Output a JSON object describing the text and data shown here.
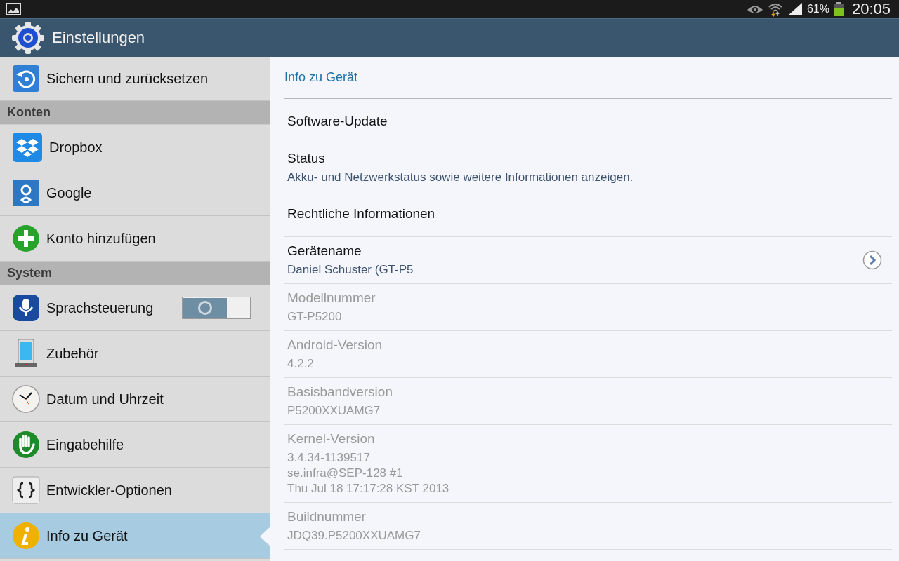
{
  "status_bar": {
    "battery": "61%",
    "time": "20:05"
  },
  "action_bar": {
    "title": "Einstellungen"
  },
  "sidebar": {
    "items": [
      {
        "kind": "item",
        "label": "Sichern und zurücksetzen",
        "selected": false
      },
      {
        "kind": "header",
        "label": "Konten"
      },
      {
        "kind": "item",
        "label": "Dropbox",
        "selected": false
      },
      {
        "kind": "item",
        "label": "Google",
        "selected": false
      },
      {
        "kind": "item",
        "label": "Konto hinzufügen",
        "selected": false
      },
      {
        "kind": "header",
        "label": "System"
      },
      {
        "kind": "toggle",
        "label": "Sprachsteuerung",
        "selected": false,
        "on": false
      },
      {
        "kind": "item",
        "label": "Zubehör",
        "selected": false
      },
      {
        "kind": "item",
        "label": "Datum und Uhrzeit",
        "selected": false
      },
      {
        "kind": "item",
        "label": "Eingabehilfe",
        "selected": false
      },
      {
        "kind": "item",
        "label": "Entwickler-Optionen",
        "selected": false
      },
      {
        "kind": "item",
        "label": "Info zu Gerät",
        "selected": true
      }
    ]
  },
  "detail": {
    "title": "Info zu Gerät",
    "rows": [
      {
        "title": "Software-Update",
        "disabled": false
      },
      {
        "title": "Status",
        "subtitle": "Akku- und Netzwerkstatus sowie weitere Informationen anzeigen.",
        "disabled": false
      },
      {
        "title": "Rechtliche Informationen",
        "disabled": false
      },
      {
        "title": "Gerätename",
        "subtitle": "Daniel Schuster (GT-P5",
        "disabled": false,
        "chevron": true
      },
      {
        "title": "Modellnummer",
        "subtitle": "GT-P5200",
        "disabled": true
      },
      {
        "title": "Android-Version",
        "subtitle": "4.2.2",
        "disabled": true
      },
      {
        "title": "Basisbandversion",
        "subtitle": "P5200XXUAMG7",
        "disabled": true
      },
      {
        "title": "Kernel-Version",
        "subtitle": "3.4.34-1139517\nse.infra@SEP-128 #1\nThu Jul 18 17:17:28 KST 2013",
        "disabled": true
      },
      {
        "title": "Buildnummer",
        "subtitle": "JDQ39.P5200XXUAMG7",
        "disabled": true
      }
    ]
  }
}
